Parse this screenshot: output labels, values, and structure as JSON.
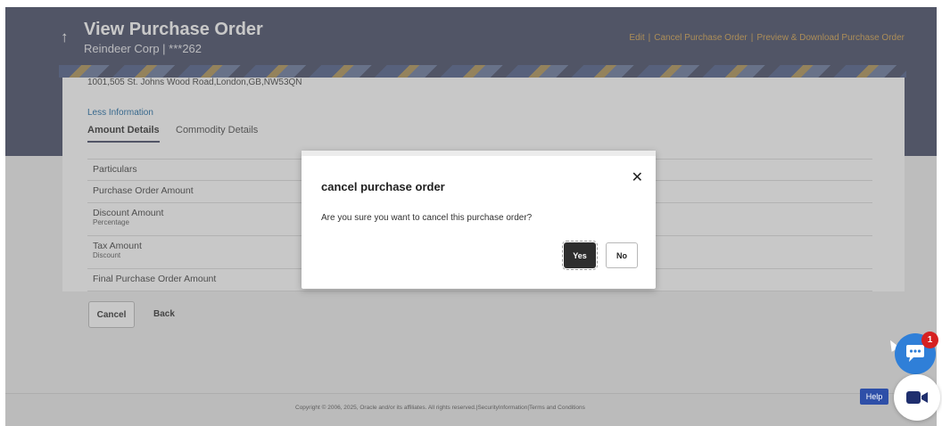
{
  "header": {
    "back_icon": "arrow-up-icon",
    "title": "View Purchase Order",
    "subtitle": "Reindeer Corp | ***262",
    "actions": {
      "edit": "Edit",
      "cancel_po": "Cancel Purchase Order",
      "preview_download": "Preview & Download Purchase Order",
      "separator": "|"
    }
  },
  "details": {
    "address": "1001,505 St. Johns Wood Road,London,GB,NW53QN",
    "less_info": "Less Information",
    "tabs": [
      {
        "label": "Amount Details"
      },
      {
        "label": "Commodity Details"
      }
    ],
    "rows": [
      {
        "label": "Particulars",
        "sub": ""
      },
      {
        "label": "Purchase Order Amount",
        "sub": ""
      },
      {
        "label": "Discount Amount",
        "sub": "Percentage"
      },
      {
        "label": "Tax Amount",
        "sub": "Discount"
      },
      {
        "label": "Final Purchase Order Amount",
        "sub": ""
      }
    ]
  },
  "buttons": {
    "cancel": "Cancel",
    "back": "Back"
  },
  "footer": {
    "text": "Copyright © 2006, 2025, Oracle and/or its affiliates. All rights reserved.|SecurityInformation|Terms and Conditions"
  },
  "modal": {
    "title": "cancel purchase order",
    "message": "Are you sure you want to cancel this purchase order?",
    "yes": "Yes",
    "no": "No",
    "close_icon": "close-icon"
  },
  "widgets": {
    "chat_badge": "1",
    "help": "Help",
    "chat_icon": "chat-bubble-icon",
    "video_icon": "video-camera-icon"
  },
  "colors": {
    "header_bg": "#3f4661",
    "action_link": "#d2a04b",
    "chat_blue": "#2f7fd8",
    "badge_red": "#d62121"
  }
}
